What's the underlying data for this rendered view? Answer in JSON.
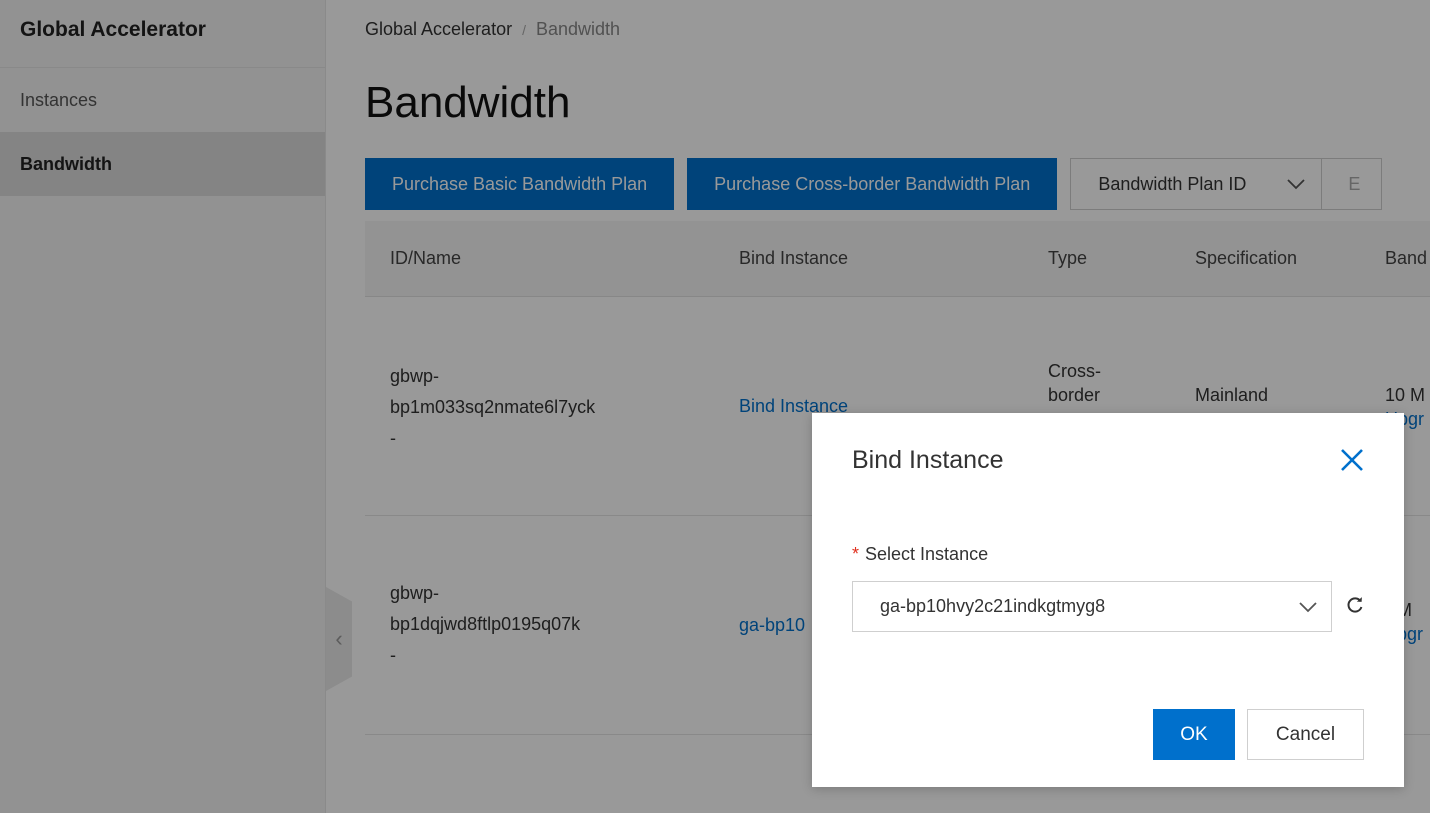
{
  "sidebar": {
    "title": "Global Accelerator",
    "items": [
      {
        "label": "Instances"
      },
      {
        "label": "Bandwidth"
      }
    ],
    "collapse_glyph": "‹"
  },
  "breadcrumb": {
    "root": "Global Accelerator",
    "separator": "/",
    "current": "Bandwidth"
  },
  "page": {
    "title": "Bandwidth"
  },
  "toolbar": {
    "purchase_basic_label": "Purchase Basic Bandwidth Plan",
    "purchase_crossborder_label": "Purchase Cross-border Bandwidth Plan",
    "filter_field_value": "Bandwidth Plan ID",
    "filter_input_placeholder": "E"
  },
  "table": {
    "headers": [
      "ID/Name",
      "Bind Instance",
      "Type",
      "Specification",
      "Band"
    ],
    "rows": [
      {
        "id_line1": "gbwp-",
        "id_line2": "bp1m033sq2nmate6l7yck",
        "name": "-",
        "bind": "Bind Instance",
        "type_line1": "Cross-",
        "type_line2": "border",
        "spec_line1": "Mainland",
        "bandwidth": "10 M",
        "upgrade": "Upgr"
      },
      {
        "id_line1": "gbwp-",
        "id_line2": "bp1dqjwd8ftlp0195q07k",
        "name": "-",
        "bind": "ga-bp10",
        "bandwidth": "M",
        "upgrade": "pgr"
      }
    ]
  },
  "dialog": {
    "title": "Bind Instance",
    "required_mark": "*",
    "field_label": "Select Instance",
    "selected_instance": "ga-bp10hvy2c21indkgtmyg8",
    "ok_label": "OK",
    "cancel_label": "Cancel"
  },
  "colors": {
    "primary": "#0070cc",
    "required": "#e0301e",
    "overlay": "rgba(0,0,0,0.4)"
  }
}
